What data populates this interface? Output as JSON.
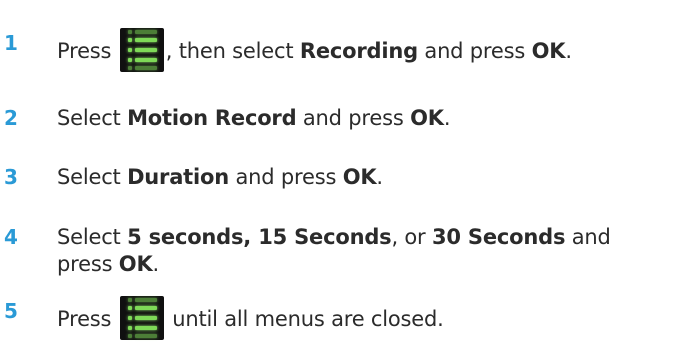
{
  "steps": [
    {
      "number": "1",
      "parts": [
        "Press",
        ", then select",
        "Recording",
        "and press",
        "OK",
        "."
      ]
    },
    {
      "number": "2",
      "parts": [
        "Select",
        "Motion Record",
        "and press",
        "OK",
        "."
      ]
    },
    {
      "number": "3",
      "parts": [
        "Select",
        "Duration",
        "and press",
        "OK",
        "."
      ]
    },
    {
      "number": "4",
      "parts": [
        "Select",
        "5 seconds, 15 Seconds",
        ", or",
        "30 Seconds",
        "and",
        "press",
        "OK",
        "."
      ]
    },
    {
      "number": "5",
      "parts": [
        "Press",
        "until all menus are closed."
      ]
    }
  ],
  "icons": {
    "menu": "menu-list-icon"
  },
  "colors": {
    "step_number": "#2a9ad6",
    "icon_background": "#101010",
    "icon_glyph": "#7ed957",
    "text": "#2b2b2b"
  }
}
